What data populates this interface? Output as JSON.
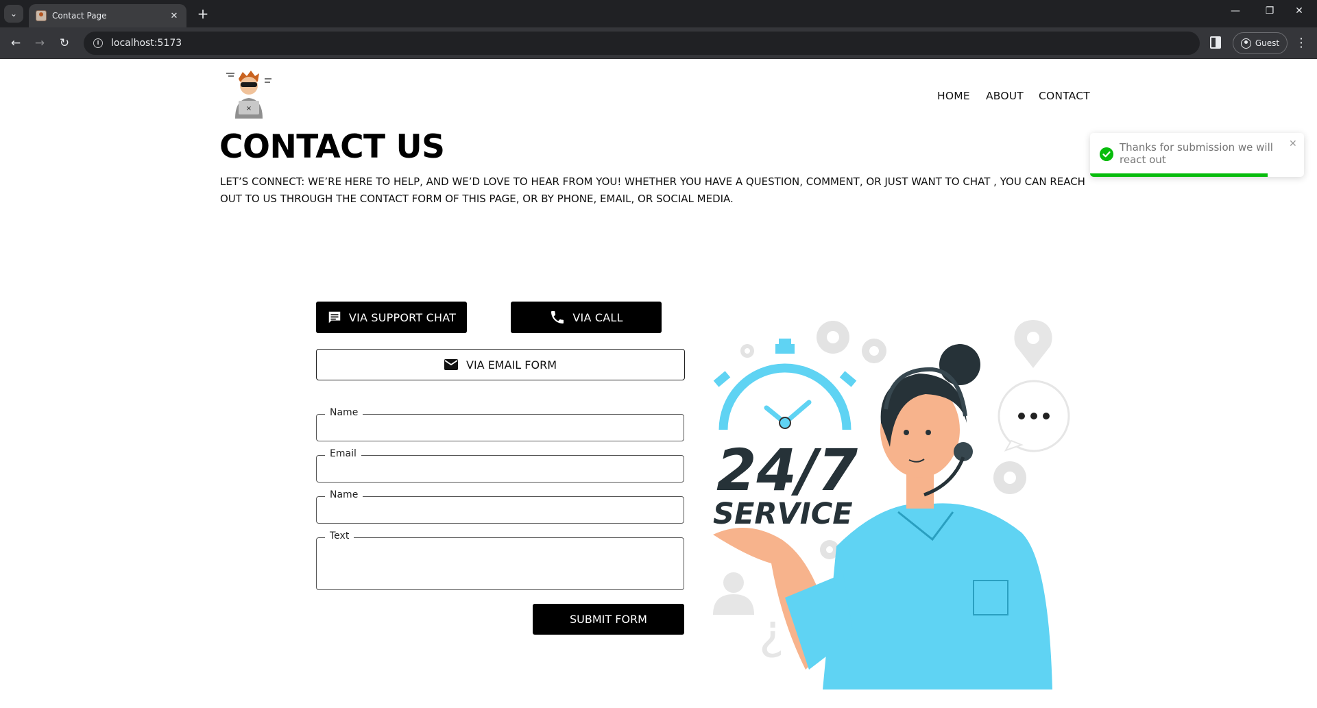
{
  "browser": {
    "tab_title": "Contact Page",
    "url": "localhost:5173",
    "profile_label": "Guest",
    "tab_close_glyph": "✕",
    "new_tab_glyph": "+",
    "back_glyph": "←",
    "forward_glyph": "→",
    "reload_glyph": "↻",
    "minimize_glyph": "—",
    "restore_glyph": "❐",
    "close_glyph": "✕",
    "menu_glyph": "⋮"
  },
  "nav": {
    "items": [
      "HOME",
      "ABOUT",
      "CONTACT"
    ]
  },
  "main": {
    "heading": "CONTACT US",
    "intro": "LET’S CONNECT: WE’RE HERE TO HELP, AND WE’D LOVE TO HEAR FROM YOU! WHETHER YOU HAVE A QUESTION, COMMENT, OR JUST WANT TO CHAT , YOU CAN REACH OUT TO US THROUGH THE CONTACT FORM OF THIS PAGE, OR BY PHONE, EMAIL, OR SOCIAL MEDIA."
  },
  "buttons": {
    "support_chat": "VIA SUPPORT CHAT",
    "call": "VIA CALL",
    "email_form": "VIA EMAIL FORM",
    "submit": "SUBMIT FORM"
  },
  "form": {
    "fields": [
      {
        "label": "Name",
        "value": ""
      },
      {
        "label": "Email",
        "value": ""
      },
      {
        "label": "Name",
        "value": ""
      },
      {
        "label": "Text",
        "value": ""
      }
    ]
  },
  "illustration": {
    "headline": "24/7",
    "subline": "SERVICE"
  },
  "toast": {
    "message": "Thanks for submission we will react out",
    "close_glyph": "✕",
    "progress": 0.83
  },
  "colors": {
    "accent_blue": "#5fd3f3",
    "toast_green": "#07bc0c",
    "button_black": "#000000"
  },
  "icons": [
    "chat-icon",
    "phone-icon",
    "mail-icon",
    "check-circle-icon",
    "info-icon",
    "guest-profile-icon"
  ]
}
